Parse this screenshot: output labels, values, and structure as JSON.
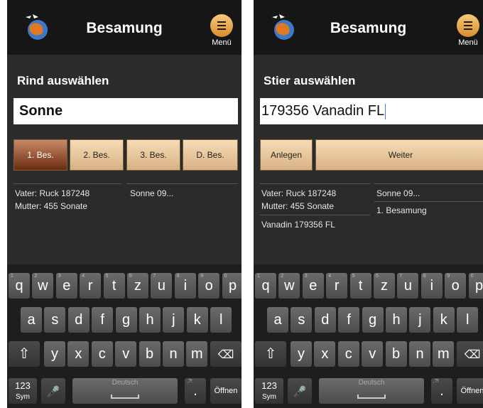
{
  "screens": [
    {
      "header": {
        "title": "Besamung",
        "menu_label": "Menü",
        "logo_icon": "globe-logo-icon",
        "menu_icon": "menu-icon"
      },
      "section_title": "Rind auswählen",
      "input_value": "Sonne",
      "buttons": [
        "1. Bes.",
        "2. Bes.",
        "3. Bes.",
        "D. Bes."
      ],
      "active_button": "1. Bes.",
      "info": {
        "vater": "Vater: Ruck 187248",
        "mutter": "Mutter: 455 Sonate",
        "right": "Sonne 09..."
      }
    },
    {
      "header": {
        "title": "Besamung",
        "menu_label": "Menü",
        "logo_icon": "globe-logo-icon",
        "menu_icon": "menu-icon"
      },
      "section_title": "Stier auswählen",
      "input_value": "179356 Vanadin FL",
      "buttons": [
        "Anlegen",
        "Weiter"
      ],
      "info": {
        "vater": "Vater: Ruck 187248",
        "mutter": "Mutter: 455 Sonate",
        "stier": "Vanadin 179356 FL",
        "right": "Sonne 09...",
        "right2": "1. Besamung"
      }
    }
  ],
  "keyboard": {
    "row1": [
      "q",
      "w",
      "e",
      "r",
      "t",
      "z",
      "u",
      "i",
      "o",
      "p"
    ],
    "row1_hints": [
      "1",
      "2",
      "3",
      "4",
      "5",
      "6",
      "7",
      "8",
      "9",
      "0"
    ],
    "row2": [
      "a",
      "s",
      "d",
      "f",
      "g",
      "h",
      "j",
      "k",
      "l"
    ],
    "row3": [
      "y",
      "x",
      "c",
      "v",
      "b",
      "n",
      "m"
    ],
    "sym_label": "123",
    "sym_sub": "Sym",
    "space_label": "Deutsch",
    "period_label": ".",
    "period_hint": ",?!",
    "enter_label": "Öffnen",
    "icons": {
      "shift": "shift-icon",
      "backspace": "backspace-icon",
      "mic": "microphone-icon",
      "settings": "settings-icon"
    }
  }
}
